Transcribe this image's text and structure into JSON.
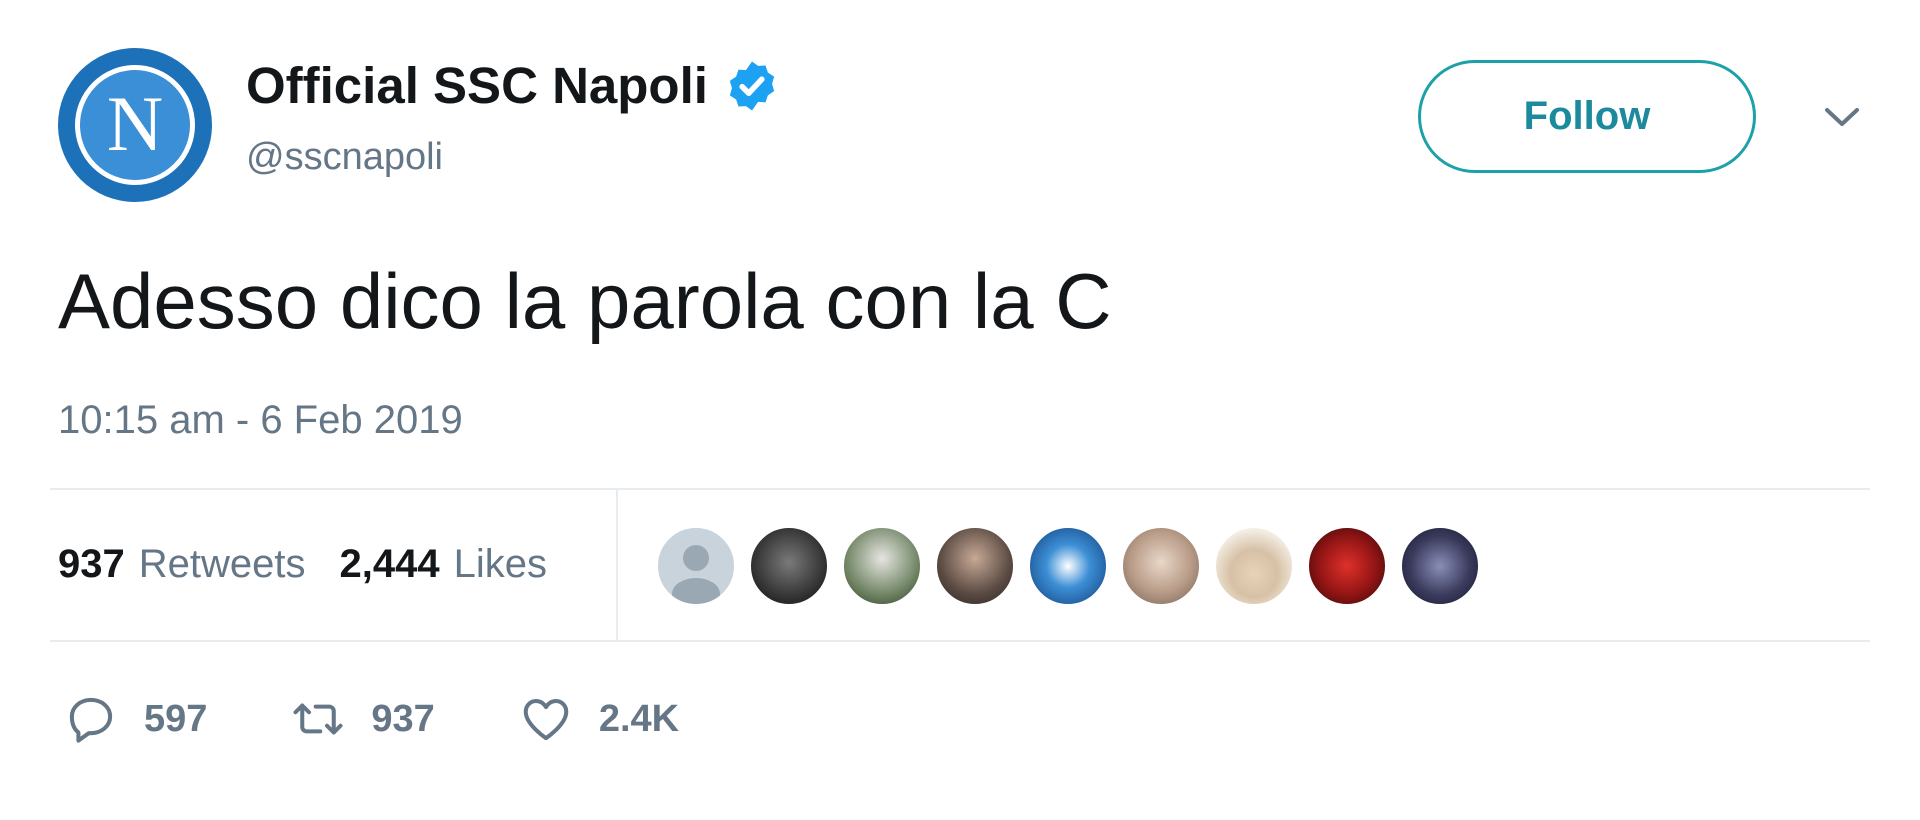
{
  "author": {
    "display_name": "Official SSC Napoli",
    "handle": "@sscnapoli",
    "avatar_letter": "N",
    "verified": true
  },
  "follow_button_label": "Follow",
  "tweet": {
    "text": "Adesso dico la parola con la C",
    "timestamp": "10:15 am - 6 Feb 2019"
  },
  "stats": {
    "retweets_count": "937",
    "retweets_label": "Retweets",
    "likes_count": "2,444",
    "likes_label": "Likes"
  },
  "actions": {
    "reply_count": "597",
    "retweet_count": "937",
    "like_count": "2.4K"
  },
  "colors": {
    "accent": "#1da1f2",
    "follow_text": "#1c8a9c",
    "muted": "#657786",
    "avatar_blue": "#1d71b8"
  }
}
